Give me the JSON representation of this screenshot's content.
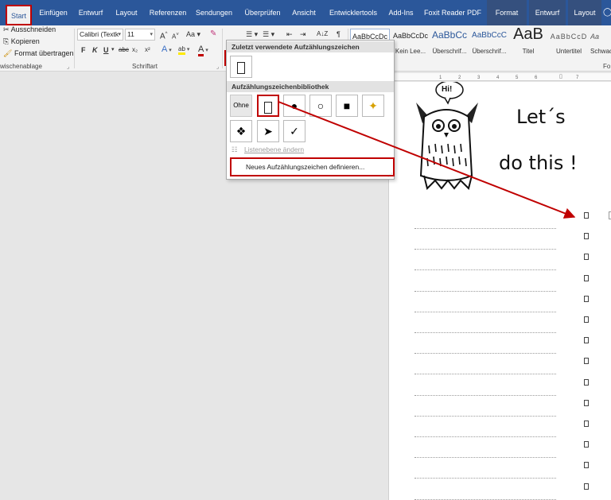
{
  "tabs": [
    {
      "label": "Start",
      "active": true
    },
    {
      "label": "Einfügen"
    },
    {
      "label": "Entwurf"
    },
    {
      "label": "Layout"
    },
    {
      "label": "Referenzen"
    },
    {
      "label": "Sendungen"
    },
    {
      "label": "Überprüfen"
    },
    {
      "label": "Ansicht"
    },
    {
      "label": "Entwicklertools"
    },
    {
      "label": "Add-Ins"
    },
    {
      "label": "Foxit Reader PDF"
    },
    {
      "label": "Format",
      "contextual": true
    },
    {
      "label": "Entwurf",
      "contextual": true
    },
    {
      "label": "Layout",
      "contextual": true
    }
  ],
  "clipboard": {
    "cut": "Ausschneiden",
    "copy": "Kopieren",
    "format_painter": "Format übertragen",
    "group_label": "wischenablage"
  },
  "font": {
    "name": "Calibri (Textk",
    "size": "11",
    "grow": "A",
    "shrink": "A",
    "case": "Aa",
    "bold": "F",
    "italic": "K",
    "underline": "U",
    "strike": "abc",
    "sub": "x₂",
    "sup": "x²",
    "effects": "A",
    "highlight": "ab",
    "color": "A",
    "group_label": "Schriftart"
  },
  "paragraph": {
    "sort": "A↓Z",
    "pilcrow": "¶"
  },
  "styles": [
    {
      "preview": "AaBbCcDc",
      "name": ""
    },
    {
      "preview": "AaBbCcDc",
      "name": "Kein Lee..."
    },
    {
      "preview": "AaBbCc",
      "name": "Überschrif..."
    },
    {
      "preview": "AaBbCcC",
      "name": "Überschrif..."
    },
    {
      "preview": "AaB",
      "name": "Titel"
    },
    {
      "preview": "AaBbCcD",
      "name": "Untertitel"
    },
    {
      "preview": "Aa",
      "name": "Schwac"
    }
  ],
  "styles_group_label": "Fo",
  "bullet_menu": {
    "recent_header": "Zuletzt verwendete Aufzählungszeichen",
    "library_header": "Aufzählungszeichenbibliothek",
    "none_label": "Ohne",
    "library": [
      "▯",
      "●",
      "○",
      "■",
      "✦",
      "❖",
      "➤",
      "✓"
    ],
    "change_level": "Listenebene ändern",
    "define_new": "Neues Aufzählungszeichen definieren..."
  },
  "document": {
    "speech": "Hi!",
    "heading_1": "Let´s",
    "heading_2": "do this !",
    "ruler_marks": [
      "1",
      "2",
      "3",
      "4",
      "5",
      "6",
      "7"
    ]
  },
  "colors": {
    "ribbon_blue": "#2b579a",
    "highlight_red": "#c00000",
    "arrow_red": "#c00000"
  }
}
